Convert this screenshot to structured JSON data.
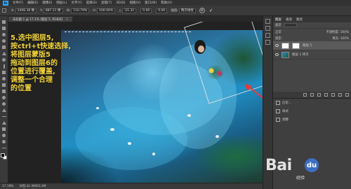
{
  "menubar": {
    "logo": "Ps",
    "items": [
      "文件(F)",
      "编辑(E)",
      "图像(I)",
      "图层(L)",
      "文字(Y)",
      "选择(S)",
      "滤镜(T)",
      "3D(D)",
      "视图(V)",
      "窗口(W)",
      "帮助(H)"
    ]
  },
  "options": {
    "x_label": "X:",
    "x_value": "2406.38 像",
    "y_label": "Y:",
    "y_value": "887.21 像",
    "w_label": "W:",
    "w_value": "110.79%",
    "h_label": "H:",
    "h_value": "100.00%",
    "angle_label": "△",
    "angle_value": "-21.32",
    "h_skew_value": "0.00",
    "v_skew_value": "0.00",
    "interp_label": "插值:",
    "interp_value": "两次线性",
    "cancel_symbol": "⊘",
    "commit_symbol": "✓"
  },
  "document_tab": {
    "title": "未标题-1 @ 17.1% (图层 5, RGB/8)",
    "close": "×"
  },
  "annotation": {
    "lines": [
      "5.选中图层5,",
      "按ctrl+t快速选择,",
      "将图层蒙版5",
      "拖动到图层6的",
      "位置进行覆盖,",
      "调整一个合理",
      "的位置"
    ]
  },
  "status": {
    "zoom": "17.19%",
    "doc_size": "文档:42.3M/63.2M"
  },
  "layers": {
    "tabs": [
      "图层",
      "通道",
      "路径"
    ],
    "filter_label": "类型",
    "blend_mode": "正常",
    "opacity_label": "不透明度:",
    "opacity_value": "100%",
    "lock_label": "锁定:",
    "fill_label": "填充:",
    "fill_value": "100%",
    "rows": [
      {
        "name": "图层 5",
        "selected": true
      },
      {
        "name": "图层 1 拷贝",
        "selected": false
      }
    ]
  },
  "history": {
    "items": [
      "历史...",
      "样式",
      "调整"
    ]
  },
  "watermark": {
    "text": "Bai",
    "paw": "du",
    "sub": "经验"
  }
}
